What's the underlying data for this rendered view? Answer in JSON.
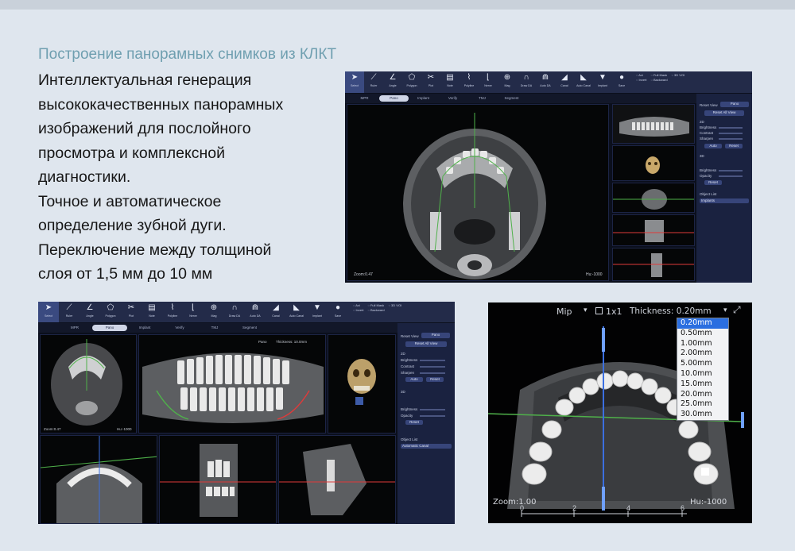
{
  "slide": {
    "subtitle": "Построение панорамных снимков из КЛКТ",
    "lines": [
      "Интеллектуальная генерация",
      "высококачественных панорамных",
      "изображений для послойного",
      "просмотра и комплексной",
      "диагностики.",
      "Точное и автоматическое",
      "определение зубной дуги.",
      "Переключение между толщиной",
      "слоя от 1,5 мм до 10 мм"
    ]
  },
  "colors": {
    "accent": "#6f9fb0",
    "toolbar": "#232b49",
    "panel": "#1a2240",
    "selection": "#2a6ee0",
    "green_line": "#4fb14a"
  },
  "tools": [
    {
      "label": "Select",
      "icon": "pointer-icon",
      "glyph": "➤"
    },
    {
      "label": "Ruler",
      "icon": "ruler-icon",
      "glyph": "⟋"
    },
    {
      "label": "Angle",
      "icon": "angle-icon",
      "glyph": "∠"
    },
    {
      "label": "Polygon",
      "icon": "polygon-icon",
      "glyph": "⬠"
    },
    {
      "label": "Plot",
      "icon": "scissors-icon",
      "glyph": "✂"
    },
    {
      "label": "Note",
      "icon": "note-icon",
      "glyph": "▤"
    },
    {
      "label": "Polyline",
      "icon": "polyline-icon",
      "glyph": "⌇"
    },
    {
      "label": "Nerve",
      "icon": "nerve-icon",
      "glyph": "⌊"
    },
    {
      "label": "Mag",
      "icon": "magnifier-icon",
      "glyph": "⊕"
    },
    {
      "label": "Draw DA",
      "icon": "arch-icon",
      "glyph": "∩"
    },
    {
      "label": "Auto DA",
      "icon": "auto-arch-icon",
      "glyph": "⋒"
    },
    {
      "label": "Canal",
      "icon": "canal-icon",
      "glyph": "◢"
    },
    {
      "label": "Auto Canal",
      "icon": "auto-canal-icon",
      "glyph": "◣"
    },
    {
      "label": "Implant",
      "icon": "implant-icon",
      "glyph": "▼"
    },
    {
      "label": "Save",
      "icon": "save-icon",
      "glyph": "●"
    }
  ],
  "tool_options": [
    "Axi",
    "Full Mask",
    "3D VOI",
    "Invert",
    "Backward"
  ],
  "tabs": [
    "MPR",
    "Pano",
    "Implant",
    "Verify",
    "TMJ",
    "Segment"
  ],
  "active_tab": "Pano",
  "side_panel": {
    "reset_view_label": "Reset View",
    "reset_view_value": "Pano",
    "reset_all_label": "Reset All View",
    "section_2d": "2D",
    "brightness": "Brightness",
    "contrast": "Contrast",
    "sharpen": "Sharpen",
    "auto": "Auto",
    "reset": "Reset",
    "section_3d": "3D",
    "opacity": "Opacity",
    "object_list": "Object List",
    "implants": "Implants",
    "auto_canal": "Automatic Canal"
  },
  "viewer": {
    "mode": "Mip",
    "checkbox_label": "1x1",
    "thickness_label": "Thickness: 0.20mm",
    "thickness_options": [
      "0.20mm",
      "0.50mm",
      "1.00mm",
      "2.00mm",
      "5.00mm",
      "10.0mm",
      "15.0mm",
      "20.0mm",
      "25.0mm",
      "30.0mm"
    ],
    "selected_thickness": "0.20mm",
    "zoom_label": "Zoom:1.00",
    "hu_label": "Hu:-1000",
    "ruler_ticks": [
      "0",
      "2",
      "4",
      "6"
    ]
  },
  "small_labels": {
    "zoom": "Zoom:0.47",
    "hu": "Hu:-1000",
    "pano": "Pano",
    "thickness_small": "Thickness: 10.0mm"
  }
}
